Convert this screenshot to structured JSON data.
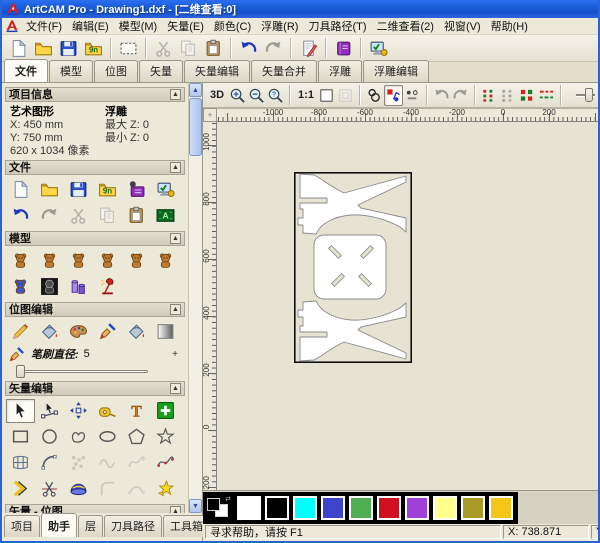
{
  "window": {
    "title": "ArtCAM Pro - Drawing1.dxf - [二维查看:0]"
  },
  "icons": {
    "collapse": "▲",
    "scroll_up": "▲",
    "scroll_down": "▼",
    "origin": "+",
    "chip_link": "⇄"
  },
  "menu": {
    "items": [
      "文件(F)",
      "编辑(E)",
      "模型(M)",
      "矢量(E)",
      "颜色(C)",
      "浮雕(R)",
      "刀具路径(T)",
      "二维查看(2)",
      "视窗(V)",
      "帮助(H)"
    ]
  },
  "main_toolbar": {
    "groups": [
      [
        {
          "n": "new-model",
          "i": "page"
        },
        {
          "n": "open-model",
          "i": "folder"
        },
        {
          "n": "save-model",
          "i": "floppy"
        },
        {
          "n": "import-relief",
          "i": "import"
        }
      ],
      [
        {
          "n": "set-model-size",
          "i": "rectd"
        }
      ],
      [
        {
          "n": "cut",
          "i": "scissors",
          "d": 1
        },
        {
          "n": "copy",
          "i": "copy",
          "d": 1
        },
        {
          "n": "paste",
          "i": "paste"
        }
      ],
      [
        {
          "n": "undo",
          "i": "undo"
        },
        {
          "n": "redo",
          "i": "redo",
          "d": 1
        }
      ],
      [
        {
          "n": "edit-notes",
          "i": "notepad"
        }
      ],
      [
        {
          "n": "reference-help",
          "i": "book"
        }
      ],
      [
        {
          "n": "options",
          "i": "monitor"
        }
      ]
    ]
  },
  "tab_bar": {
    "tabs": [
      {
        "label": "文件",
        "active": true
      },
      {
        "label": "模型"
      },
      {
        "label": "位图"
      },
      {
        "label": "矢量"
      },
      {
        "label": "矢量编辑"
      },
      {
        "label": "矢量合并"
      },
      {
        "label": "浮雕"
      },
      {
        "label": "浮雕编辑"
      }
    ]
  },
  "assistant": {
    "project_info": {
      "title": "项目信息",
      "col1_header": "艺术图形",
      "col2_header": "浮雕",
      "x": "X: 450 mm",
      "max": "最大  Z: 0",
      "y": "Y: 750 mm",
      "min": "最小  Z: 0",
      "pixels": "620 x 1034 像素"
    },
    "file": {
      "title": "文件",
      "rows": [
        [
          {
            "n": "new-model",
            "i": "page"
          },
          {
            "n": "open-model",
            "i": "folder"
          },
          {
            "n": "save-model",
            "i": "floppy"
          },
          {
            "n": "import-relief",
            "i": "import"
          },
          {
            "n": "artcam-wizard",
            "i": "wizbook"
          },
          {
            "n": "options",
            "i": "monitor"
          }
        ],
        [
          {
            "n": "undo",
            "i": "undo"
          },
          {
            "n": "redo",
            "i": "redo",
            "d": 1
          },
          {
            "n": "cut",
            "i": "scissors",
            "d": 1
          },
          {
            "n": "copy",
            "i": "copy",
            "d": 1
          },
          {
            "n": "paste",
            "i": "paste"
          },
          {
            "n": "create-text-abc",
            "i": "abc"
          }
        ]
      ]
    },
    "model": {
      "title": "模型",
      "rows": [
        [
          {
            "n": "set-model-size",
            "i": "bear"
          },
          {
            "n": "set-model-origin",
            "i": "bear"
          },
          {
            "n": "mirror-model",
            "i": "bear"
          },
          {
            "n": "rotate-model",
            "i": "bear"
          },
          {
            "n": "flip-model",
            "i": "bear"
          },
          {
            "n": "wrap-model",
            "i": "bear"
          }
        ],
        [
          {
            "n": "offset-model",
            "i": "bear",
            "c": "#4455cc"
          },
          {
            "n": "greyscale-model",
            "i": "bearbw"
          },
          {
            "n": "swap-relief-layers",
            "i": "cylinders"
          },
          {
            "n": "lighting",
            "i": "lamp"
          }
        ]
      ]
    },
    "bitmap": {
      "title": "位图编辑",
      "brush_label": "笔刷直径:",
      "brush_value": "5",
      "rows": [
        [
          {
            "n": "draw-pencil",
            "i": "pencil"
          },
          {
            "n": "flood-fill",
            "i": "bucket"
          },
          {
            "n": "colour-palette",
            "i": "palette"
          },
          {
            "n": "paint-brush",
            "i": "brushbig"
          },
          {
            "n": "flood-fill-local",
            "i": "bucket"
          },
          {
            "n": "gradient-fill",
            "i": "gradient"
          }
        ]
      ],
      "brush_icon": {
        "n": "draw-brush",
        "i": "brushbig"
      }
    },
    "vector": {
      "title": "矢量编辑",
      "rows": [
        [
          {
            "n": "select-vectors",
            "i": "cursor",
            "p": 1
          },
          {
            "n": "node-editing",
            "i": "node"
          },
          {
            "n": "transform-vectors",
            "i": "transform"
          },
          {
            "n": "measure-tool",
            "i": "measure"
          },
          {
            "n": "create-text",
            "i": "textT"
          },
          {
            "n": "create-vector-block",
            "i": "plusgreen"
          }
        ],
        [
          {
            "n": "create-rectangle",
            "i": "squareo"
          },
          {
            "n": "create-circle",
            "i": "circleo"
          },
          {
            "n": "create-freehand",
            "i": "free"
          },
          {
            "n": "create-ellipse",
            "i": "ellipseo"
          },
          {
            "n": "create-polygon",
            "i": "pentagon"
          },
          {
            "n": "create-star",
            "i": "staro"
          }
        ],
        [
          {
            "n": "envelope-distort",
            "i": "grid"
          },
          {
            "n": "create-arc",
            "i": "arc"
          },
          {
            "n": "block-copy",
            "i": "dots",
            "d": 1
          },
          {
            "n": "fit-curve",
            "i": "wave",
            "d": 1
          },
          {
            "n": "smooth-polyline",
            "i": "splineg",
            "d": 1
          },
          {
            "n": "create-polyline",
            "i": "spline"
          }
        ],
        [
          {
            "n": "arrow-edit",
            "i": "chevron"
          },
          {
            "n": "trim-vectors",
            "i": "trim"
          },
          {
            "n": "wrap-vectors",
            "i": "dome"
          },
          {
            "n": "fillet-vectors",
            "i": "filletg",
            "d": 1
          },
          {
            "n": "join-vectors",
            "i": "joing",
            "d": 1
          },
          {
            "n": "vector-doctor",
            "i": "staryellow"
          }
        ]
      ]
    },
    "vector_bitmap": {
      "title": "矢量 - 位图"
    },
    "bottom_tabs": [
      {
        "label": "项目"
      },
      {
        "label": "助手",
        "active": true
      },
      {
        "label": "层"
      },
      {
        "label": "刀具路径"
      },
      {
        "label": "工具箱"
      }
    ]
  },
  "view_toolbar": {
    "items": [
      {
        "n": "view-3d",
        "t": "3D"
      },
      {
        "n": "zoom-in",
        "i": "magplus"
      },
      {
        "n": "zoom-out",
        "i": "magminus"
      },
      {
        "n": "zoom-objects",
        "i": "magq"
      },
      {
        "sep": 1
      },
      {
        "n": "scale-1-1",
        "t": "1:1"
      },
      {
        "n": "toggle-frame",
        "i": "sqwhite"
      },
      {
        "n": "toggle-page",
        "i": "sqgray",
        "d": 1
      },
      {
        "sep": 1
      },
      {
        "n": "toggle-bitmap",
        "i": "bmpvis"
      },
      {
        "n": "toggle-vectors",
        "i": "dotsrb",
        "p": 1
      },
      {
        "n": "preview-relief",
        "i": "previewdots"
      },
      {
        "sep": 1
      },
      {
        "n": "undo",
        "i": "undo",
        "d": 1
      },
      {
        "n": "redo",
        "i": "redo",
        "d": 1
      },
      {
        "sep": 1
      },
      {
        "n": "node-snap-a",
        "i": "dots2"
      },
      {
        "n": "node-snap-b",
        "i": "dots2",
        "d": 1
      },
      {
        "n": "node-snap-c",
        "i": "dots2b"
      },
      {
        "n": "node-snap-d",
        "i": "dashdots"
      },
      {
        "sep": 1
      }
    ]
  },
  "rulers": {
    "top": [
      "-1000",
      "-800",
      "-600",
      "-400",
      "-200",
      "0",
      "200"
    ],
    "left": [
      "1000",
      "800",
      "600",
      "400",
      "200",
      "0",
      "-200"
    ]
  },
  "palette": {
    "primary": "#000000",
    "secondary": "#ffffff",
    "swatches": [
      "#ffffff",
      "#000000",
      "#00ffff",
      "#3a45cc",
      "#4fae4f",
      "#d01020",
      "#a040d8",
      "#ffff90",
      "#a89b28",
      "#f5c518"
    ]
  },
  "status": {
    "help": "寻求帮助，请按 F1",
    "x_coord": "X: 738.871",
    "y_coord": "Y"
  }
}
